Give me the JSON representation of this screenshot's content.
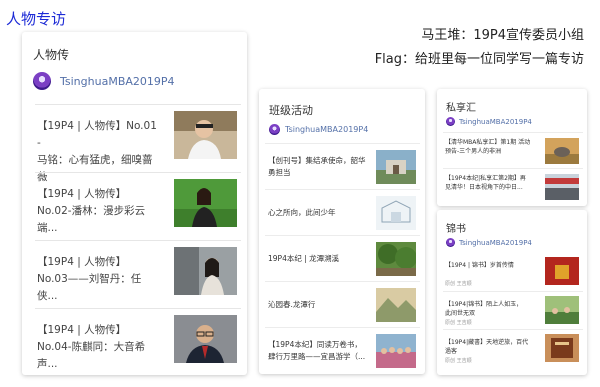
{
  "page_title": "人物专访",
  "header": {
    "line1": "马王堆：19P4宣传委员小组",
    "line2": "Flag：给班里每一位同学写一篇专访"
  },
  "account_name": "TsinghuaMBA2019P4",
  "card_persons": {
    "title": "人物传",
    "items": [
      {
        "text": "【19P4 | 人物传】No.01 -\n马铭：心有猛虎，细嗅蔷薇",
        "thumb": "person-photo-white-shirt"
      },
      {
        "text": "【19P4 | 人物传】\nNo.02-潘林：漫步彩云端...",
        "thumb": "person-photo-green-field"
      },
      {
        "text": "【19P4 | 人物传】\nNo.03——刘智丹：任侠...",
        "thumb": "person-photo-street"
      },
      {
        "text": "【19P4 | 人物传】\nNo.04-陈麒同：大音希声...",
        "thumb": "person-photo-suit-glasses"
      }
    ]
  },
  "card_class": {
    "title": "班级活动",
    "items": [
      {
        "text": "【创刊号】集结承使命，韶华\n勇担当",
        "thumb": "campus-gate-photo"
      },
      {
        "text": "心之所向，此间少年",
        "thumb": "architecture-sketch"
      },
      {
        "text": "19P4本纪 | 龙潭溯溪",
        "thumb": "green-trees-photo"
      },
      {
        "text": "沁园春.龙潭行",
        "thumb": "landscape-painting"
      },
      {
        "text": "【19P4本纪】同读万卷书，\n肆行万里路——宜昌游学（...",
        "thumb": "group-photo"
      }
    ]
  },
  "card_private": {
    "title": "私享汇",
    "items": [
      {
        "text": "【清华MBA私享汇】第1期 活动\n预告-三个男人的非洲",
        "thumb": "africa-elephant-photo"
      },
      {
        "text": "【19P4本纪|私享汇第2期】再\n见清华！日本视角下的中日...",
        "thumb": "group-banner-photo"
      }
    ]
  },
  "card_books": {
    "title": "锦书",
    "items": [
      {
        "text": "【19P4 | 锦书】岁首传情",
        "source": "原创 王吉顺",
        "thumb": "red-gift-photo"
      },
      {
        "text": "【19P4|锦书】陌上人如玉，\n此间世无双",
        "source": "原创 王吉顺",
        "thumb": "group-outdoor-photo"
      },
      {
        "text": "【19P4|藏書】天地逆旅，百代\n過客",
        "source": "原创 王吉顺",
        "thumb": "book-cover-photo"
      }
    ]
  },
  "colors": {
    "title_blue": "#1d2bd6",
    "account_blue": "#5470a8",
    "avatar_purple": "#7b3fc4"
  }
}
